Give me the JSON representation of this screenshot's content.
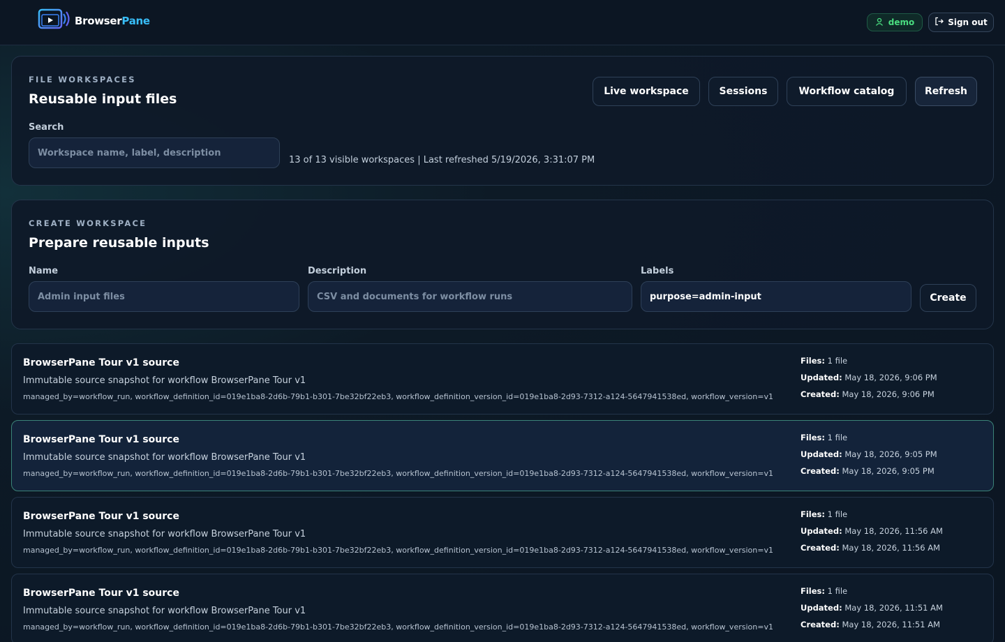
{
  "app": {
    "brand_part1": "Browser",
    "brand_part2": "Pane",
    "user": "demo",
    "sign_out": "Sign out"
  },
  "workspaces_panel": {
    "eyebrow": "FILE WORKSPACES",
    "title": "Reusable input files",
    "search_label": "Search",
    "search_placeholder": "Workspace name, label, description",
    "search_value": "",
    "status_text": "13 of 13 visible workspaces | Last refreshed 5/19/2026, 3:31:07 PM",
    "buttons": {
      "live_workspace": "Live workspace",
      "sessions": "Sessions",
      "workflow_catalog": "Workflow catalog",
      "refresh": "Refresh"
    }
  },
  "create_panel": {
    "eyebrow": "CREATE WORKSPACE",
    "title": "Prepare reusable inputs",
    "name_label": "Name",
    "name_placeholder": "Admin input files",
    "description_label": "Description",
    "description_placeholder": "CSV and documents for workflow runs",
    "labels_label": "Labels",
    "labels_value": "purpose=admin-input",
    "create_button": "Create"
  },
  "meta_keys": {
    "files": "Files:",
    "updated": "Updated:",
    "created": "Created:"
  },
  "workspaces": [
    {
      "title": "BrowserPane Tour v1 source",
      "description": "Immutable source snapshot for workflow BrowserPane Tour v1",
      "labels": "managed_by=workflow_run, workflow_definition_id=019e1ba8-2d6b-79b1-b301-7be32bf22eb3, workflow_definition_version_id=019e1ba8-2d93-7312-a124-5647941538ed, workflow_version=v1",
      "files": "1 file",
      "updated": "May 18, 2026, 9:06 PM",
      "created": "May 18, 2026, 9:06 PM",
      "selected": false
    },
    {
      "title": "BrowserPane Tour v1 source",
      "description": "Immutable source snapshot for workflow BrowserPane Tour v1",
      "labels": "managed_by=workflow_run, workflow_definition_id=019e1ba8-2d6b-79b1-b301-7be32bf22eb3, workflow_definition_version_id=019e1ba8-2d93-7312-a124-5647941538ed, workflow_version=v1",
      "files": "1 file",
      "updated": "May 18, 2026, 9:05 PM",
      "created": "May 18, 2026, 9:05 PM",
      "selected": true
    },
    {
      "title": "BrowserPane Tour v1 source",
      "description": "Immutable source snapshot for workflow BrowserPane Tour v1",
      "labels": "managed_by=workflow_run, workflow_definition_id=019e1ba8-2d6b-79b1-b301-7be32bf22eb3, workflow_definition_version_id=019e1ba8-2d93-7312-a124-5647941538ed, workflow_version=v1",
      "files": "1 file",
      "updated": "May 18, 2026, 11:56 AM",
      "created": "May 18, 2026, 11:56 AM",
      "selected": false
    },
    {
      "title": "BrowserPane Tour v1 source",
      "description": "Immutable source snapshot for workflow BrowserPane Tour v1",
      "labels": "managed_by=workflow_run, workflow_definition_id=019e1ba8-2d6b-79b1-b301-7be32bf22eb3, workflow_definition_version_id=019e1ba8-2d93-7312-a124-5647941538ed, workflow_version=v1",
      "files": "1 file",
      "updated": "May 18, 2026, 11:51 AM",
      "created": "May 18, 2026, 11:51 AM",
      "selected": false
    }
  ]
}
